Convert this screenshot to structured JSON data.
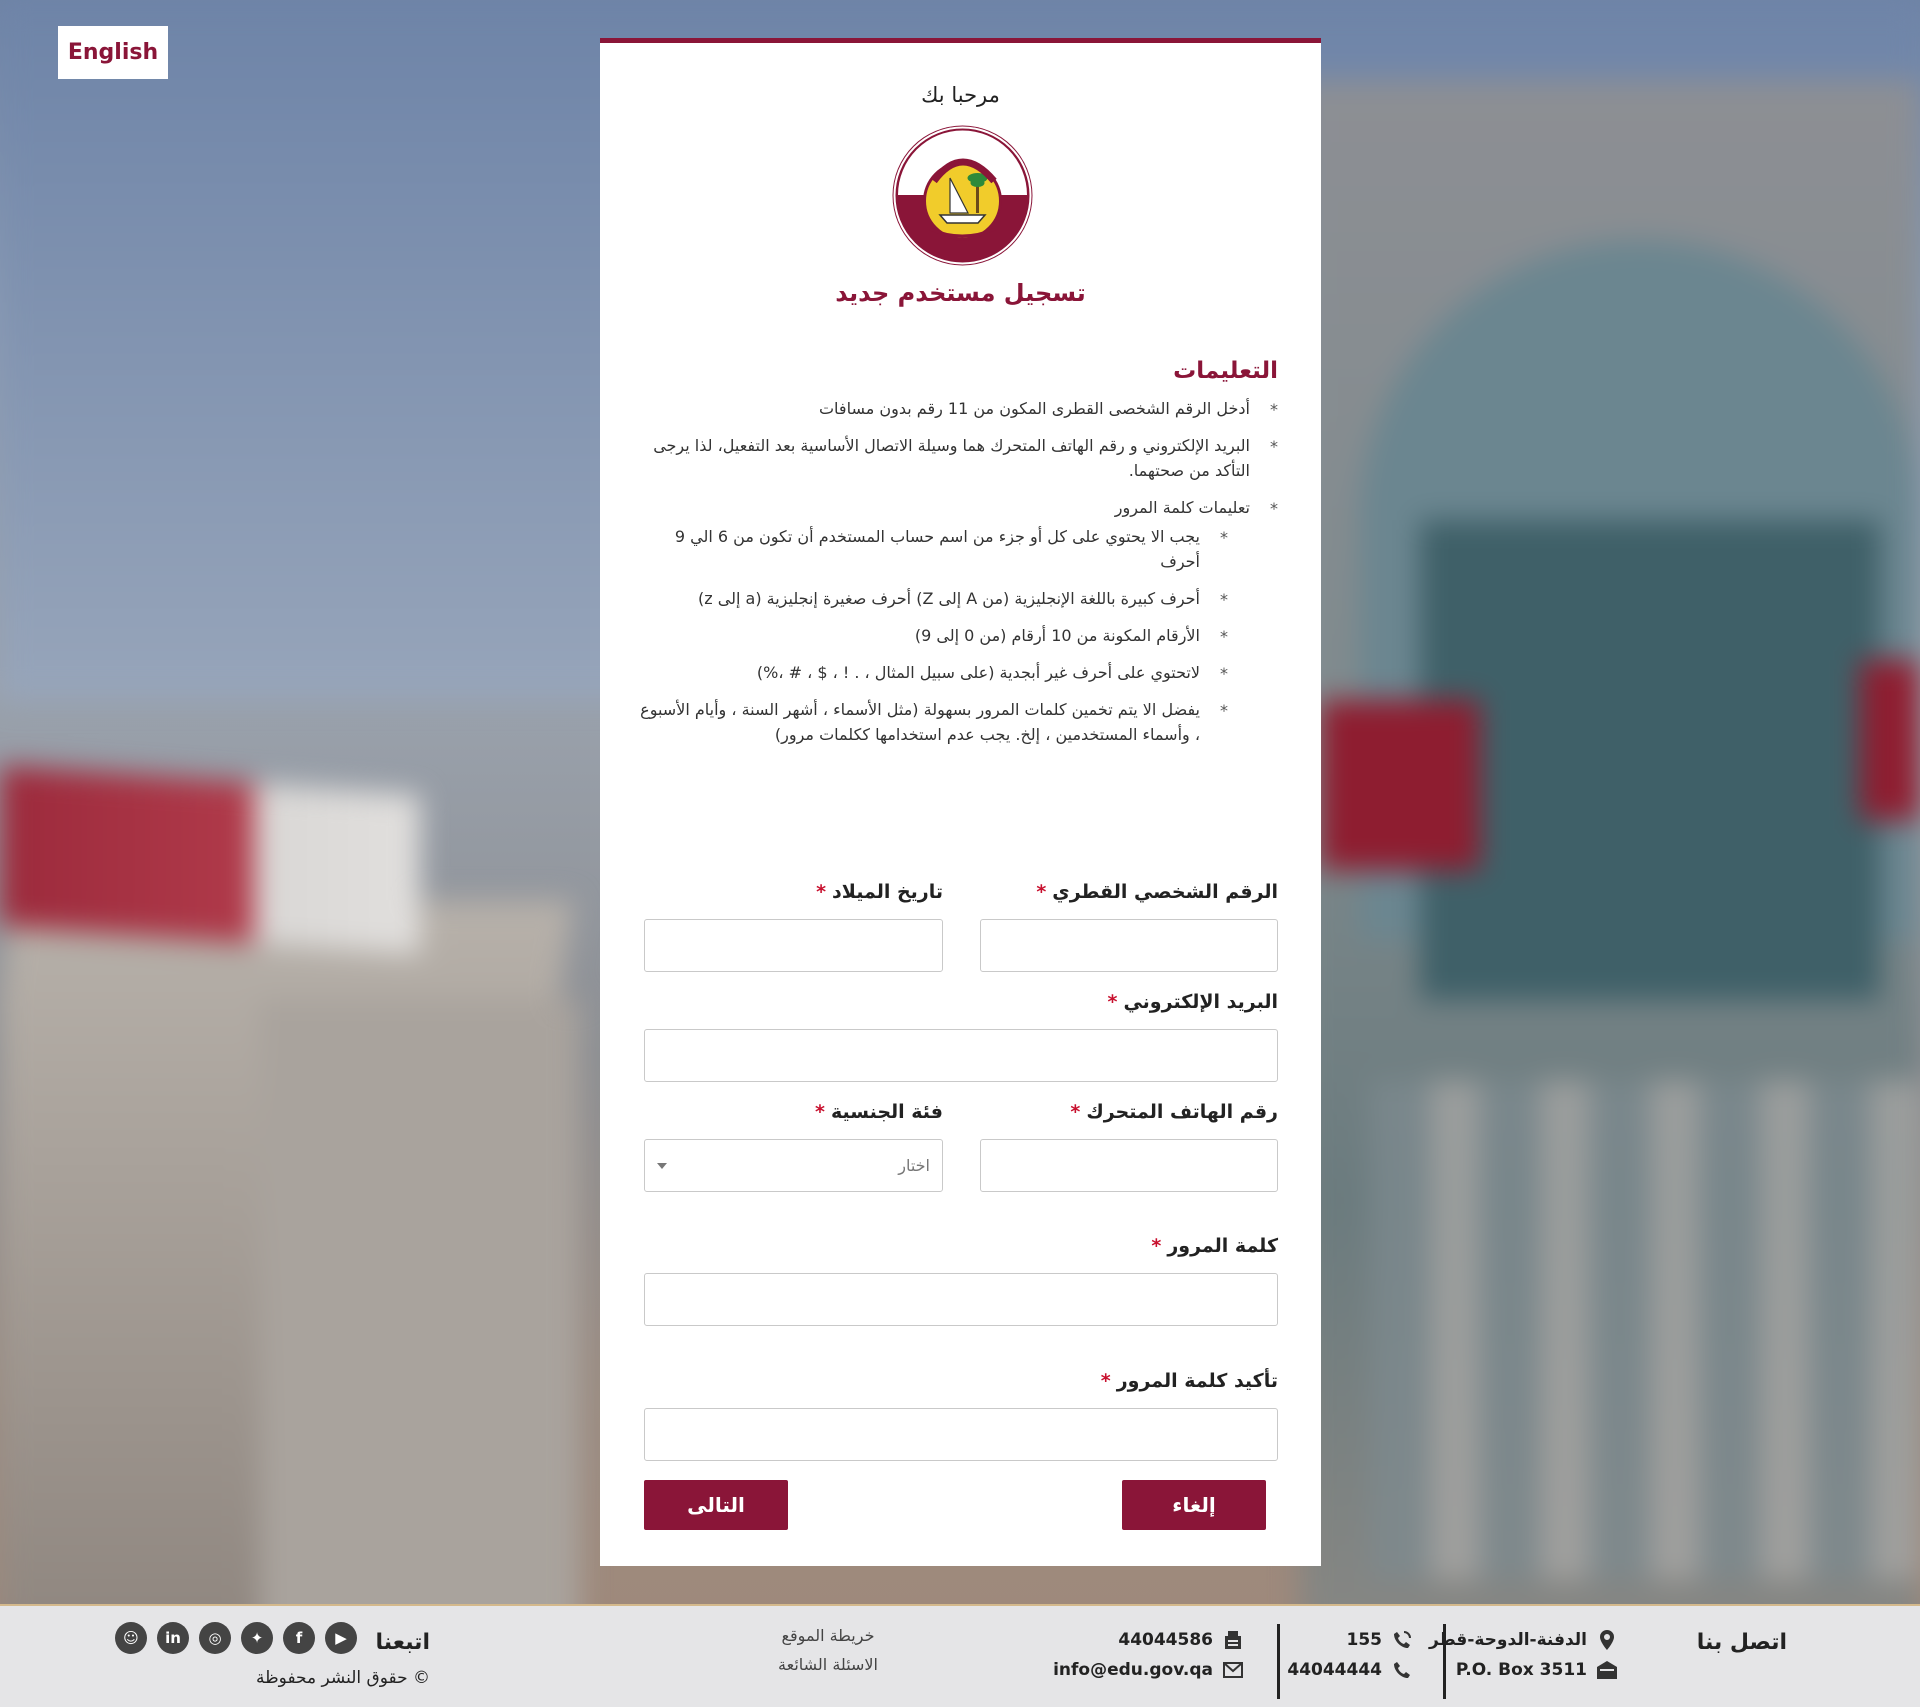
{
  "lang_toggle": "English",
  "card": {
    "welcome": "مرحبا بك",
    "title": "تسجيل مستخدم جديد",
    "instructions": {
      "heading": "التعليمات",
      "items": [
        "أدخل الرقم الشخصى القطرى المكون من 11 رقم بدون مسافات",
        "البريد الإلكتروني و رقم الهاتف المتحرك هما وسيلة الاتصال الأساسية بعد التفعيل، لذا يرجى التأكد من صحتهما.",
        "تعليمات كلمة المرور"
      ],
      "password_rules": [
        "يجب الا يحتوي على كل أو جزء من اسم حساب المستخدم أن تكون من 6 الي 9 أحرف",
        "أحرف كبيرة باللغة الإنجليزية (من A إلى Z) أحرف صغيرة إنجليزية (a إلى z)",
        "الأرقام المكونة من 10 أرقام (من 0 إلى 9)",
        "لاتحتوي على أحرف غير أبجدية (على سبيل المثال ، . ! ، $ ، # ،%)",
        "يفضل الا يتم تخمين كلمات المرور بسهولة (مثل الأسماء ، أشهر السنة ، وأيام الأسبوع ، وأسماء المستخدمين ، إلخ. يجب عدم استخدامها ككلمات مرور)"
      ]
    },
    "form": {
      "required_mark": "*",
      "qid_label": "الرقم الشخصي القطري",
      "qid_value": "",
      "dob_label": "تاريخ الميلاد",
      "dob_value": "",
      "email_label": "البريد الإلكتروني",
      "email_value": "",
      "mobile_label": "رقم الهاتف المتحرك",
      "mobile_value": "",
      "nationality_label": "فئة الجنسية",
      "nationality_selected": "اختار",
      "password_label": "كلمة المرور",
      "password_value": "",
      "confirm_password_label": "تأكيد كلمة المرور",
      "confirm_password_value": ""
    },
    "buttons": {
      "cancel": "إلغاء",
      "next": "التالى"
    }
  },
  "footer": {
    "contact_title": "اتصل بنا",
    "address": "الدفنة-الدوحة-قطر",
    "po_box": "P.O. Box 3511",
    "hotline": "155",
    "phone": "44044444",
    "fax": "44044586",
    "email": "info@edu.gov.qa",
    "sitemap": "خريطة الموقع",
    "faq": "الاسئلة الشائعة",
    "follow_title": "اتبعنا",
    "copyright": "© حقوق النشر محفوظة",
    "social_icons": [
      "youtube-icon",
      "facebook-icon",
      "twitter-icon",
      "instagram-icon",
      "linkedin-icon",
      "snapchat-icon"
    ]
  },
  "colors": {
    "brand": "#8a1538",
    "required": "#c8102e",
    "footer_bg": "#e5e5e7"
  }
}
